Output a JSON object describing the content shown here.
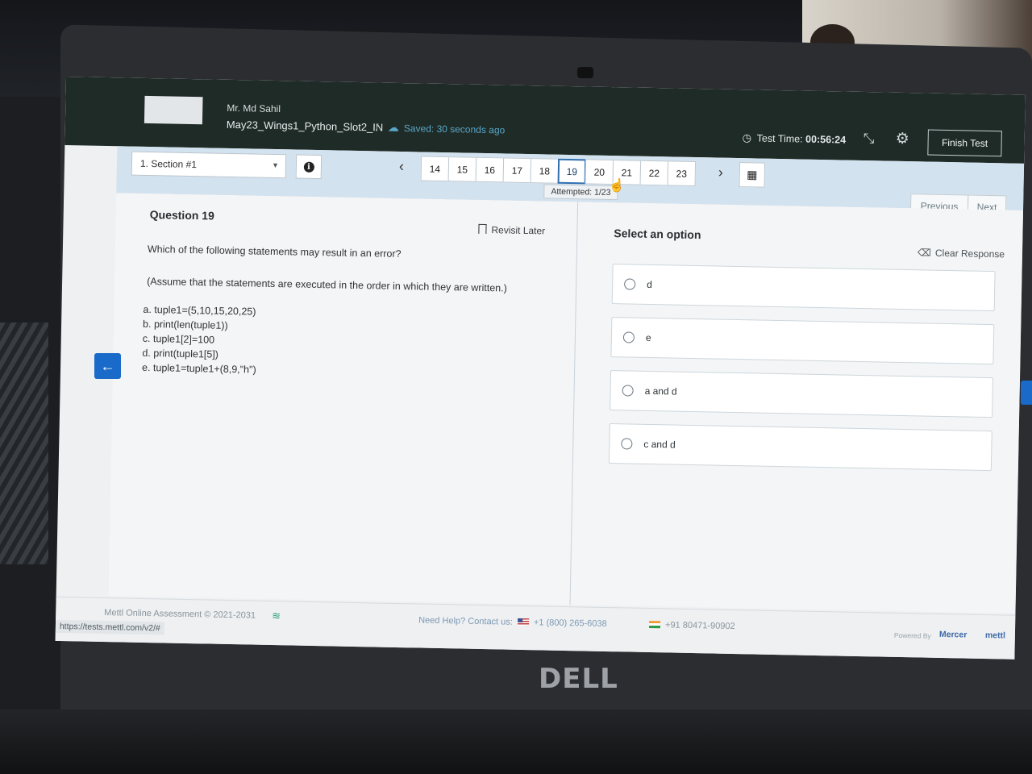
{
  "header": {
    "candidate_name": "Mr. Md Sahil",
    "test_name": "May23_Wings1_Python_Slot2_IN",
    "separator": "/",
    "saved_status": "Saved: 30 seconds ago",
    "timer_label": "Test Time:",
    "timer_value": "00:56:24",
    "finish_label": "Finish Test"
  },
  "toolbar": {
    "section": "1. Section #1",
    "question_numbers": [
      "14",
      "15",
      "16",
      "17",
      "18",
      "19",
      "20",
      "21",
      "22",
      "23"
    ],
    "current_question": "19",
    "attempted": "Attempted: 1/23",
    "previous_label": "Previous",
    "next_label": "Next"
  },
  "question": {
    "title": "Question 19",
    "revisit_label": "Revisit Later",
    "text": "Which of the following statements may result in an error?",
    "note": "(Assume that the statements are executed in the order in which they are written.)",
    "statements": [
      "a. tuple1=(5,10,15,20,25)",
      "b. print(len(tuple1))",
      "c. tuple1[2]=100",
      "d. print(tuple1[5])",
      "e. tuple1=tuple1+(8,9,\"h\")"
    ]
  },
  "options": {
    "title": "Select an option",
    "clear_label": "Clear Response",
    "items": [
      "d",
      "e",
      "a and d",
      "c and d"
    ]
  },
  "footer": {
    "copyright": "Mettl Online Assessment © 2021-2031",
    "url": "https://tests.mettl.com/v2/#",
    "help_label": "Need Help? Contact us:",
    "phone_us": "+1 (800) 265-6038",
    "phone_in": "+91 80471-90902",
    "powered_by": "Powered By",
    "mercer": "Mercer",
    "mettl": "mettl"
  },
  "hardware": {
    "brand": "DELL"
  },
  "icons": {
    "cloud": "cloud-icon",
    "clock": "clock-icon",
    "settings": "gear-icon",
    "fullscreen": "compress-icon",
    "info": "info-icon",
    "bookmark": "bookmark-icon",
    "eraser": "eraser-icon",
    "grid": "grid-icon",
    "wifi": "wifi-icon"
  },
  "colors": {
    "header_bg": "#1f2b26",
    "accent_blue": "#1a6ac9",
    "toolbar_bg": "#d3e2ef"
  }
}
